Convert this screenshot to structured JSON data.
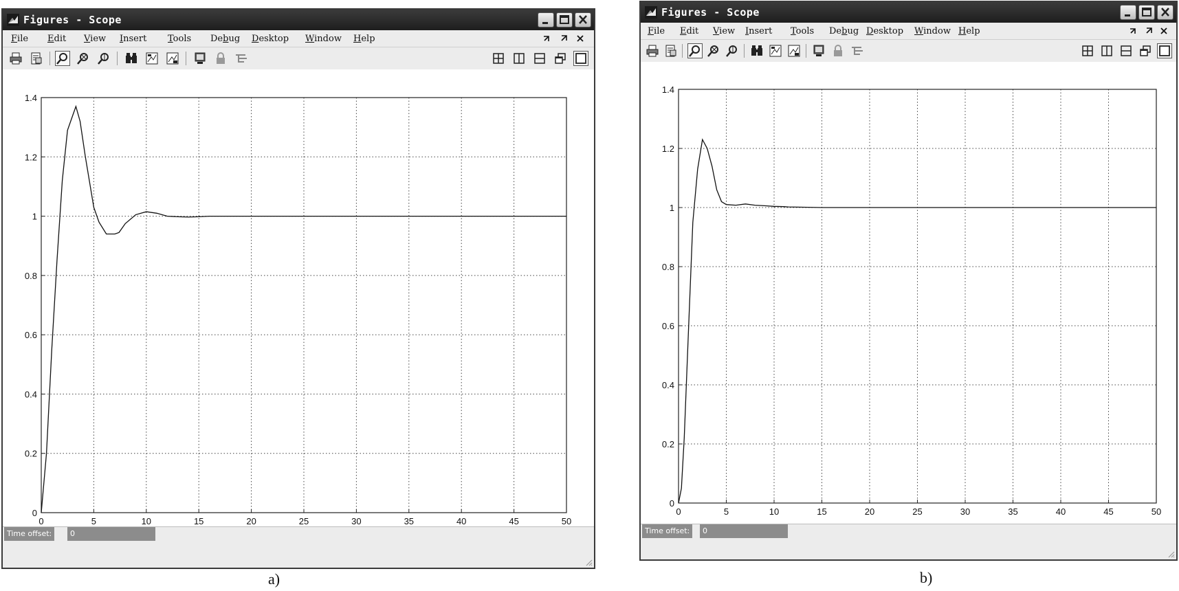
{
  "windows": [
    {
      "title": "Figures - Scope",
      "caption": "a)",
      "menu": [
        {
          "label": "File",
          "mnemonic": "F"
        },
        {
          "label": "Edit",
          "mnemonic": "E"
        },
        {
          "label": "View",
          "mnemonic": "V"
        },
        {
          "label": "Insert",
          "mnemonic": "I"
        },
        {
          "label": "Tools",
          "mnemonic": "T"
        },
        {
          "label": "Debug",
          "mnemonic": "b"
        },
        {
          "label": "Desktop",
          "mnemonic": "D"
        },
        {
          "label": "Window",
          "mnemonic": "W"
        },
        {
          "label": "Help",
          "mnemonic": "H"
        }
      ],
      "time_offset_label": "Time offset:",
      "time_offset_value": "0"
    },
    {
      "title": "Figures - Scope",
      "caption": "b)",
      "menu": [
        {
          "label": "File",
          "mnemonic": "F"
        },
        {
          "label": "Edit",
          "mnemonic": "E"
        },
        {
          "label": "View",
          "mnemonic": "V"
        },
        {
          "label": "Insert",
          "mnemonic": "I"
        },
        {
          "label": "Tools",
          "mnemonic": "T"
        },
        {
          "label": "Debug",
          "mnemonic": "b"
        },
        {
          "label": "Desktop",
          "mnemonic": "D"
        },
        {
          "label": "Window",
          "mnemonic": "W"
        },
        {
          "label": "Help",
          "mnemonic": "H"
        }
      ],
      "time_offset_label": "Time offset:",
      "time_offset_value": "0"
    }
  ],
  "icons": {
    "title": "matlab-icon",
    "title_buttons": [
      "minimize-icon",
      "maximize-icon",
      "close-icon"
    ],
    "menu_right": [
      "undock-arrow-icon",
      "dock-arrow-icon",
      "close-figure-icon"
    ],
    "toolbar_left": [
      "print-icon",
      "print-preview-icon",
      "zoom-icon",
      "zoom-x-icon",
      "zoom-y-icon",
      "find-icon",
      "save-axes-icon",
      "restore-axes-icon",
      "scope-params-icon",
      "float-lock-icon",
      "signal-select-icon"
    ],
    "toolbar_right": [
      "tile-2x2-icon",
      "tile-columns-icon",
      "tile-rows-icon",
      "float-icon",
      "dock-icon"
    ]
  },
  "chart_data": [
    {
      "type": "line",
      "title": "",
      "xlabel": "",
      "ylabel": "",
      "xlim": [
        0,
        50
      ],
      "ylim": [
        0,
        1.4
      ],
      "xticks": [
        0,
        5,
        10,
        15,
        20,
        25,
        30,
        35,
        40,
        45,
        50
      ],
      "yticks": [
        0,
        0.2,
        0.4,
        0.6,
        0.8,
        1,
        1.2,
        1.4
      ],
      "xtick_labels": [
        "0",
        "5",
        "10",
        "15",
        "20",
        "25",
        "30",
        "35",
        "40",
        "45",
        "50"
      ],
      "ytick_labels": [
        "0",
        "0.2",
        "0.4",
        "0.6",
        "0.8",
        "1",
        "1.2",
        "1.4"
      ],
      "grid": true,
      "x": [
        0,
        0.5,
        1,
        1.5,
        2,
        2.5,
        3,
        3.3,
        3.7,
        4.2,
        5,
        5.5,
        6.2,
        7,
        7.4,
        8,
        9,
        10,
        11,
        12,
        13,
        14,
        15,
        16,
        20,
        30,
        40,
        50
      ],
      "y": [
        0,
        0.2,
        0.55,
        0.85,
        1.12,
        1.29,
        1.34,
        1.37,
        1.32,
        1.2,
        1.03,
        0.98,
        0.94,
        0.94,
        0.945,
        0.975,
        1.005,
        1.015,
        1.01,
        1.0,
        0.998,
        0.997,
        0.998,
        1.0,
        1.0,
        1.0,
        1.0,
        1.0
      ]
    },
    {
      "type": "line",
      "title": "",
      "xlabel": "",
      "ylabel": "",
      "xlim": [
        0,
        50
      ],
      "ylim": [
        0,
        1.4
      ],
      "xticks": [
        0,
        5,
        10,
        15,
        20,
        25,
        30,
        35,
        40,
        45,
        50
      ],
      "yticks": [
        0,
        0.2,
        0.4,
        0.6,
        0.8,
        1,
        1.2,
        1.4
      ],
      "xtick_labels": [
        "0",
        "5",
        "10",
        "15",
        "20",
        "25",
        "30",
        "35",
        "40",
        "45",
        "50"
      ],
      "ytick_labels": [
        "0",
        "0.2",
        "0.4",
        "0.6",
        "0.8",
        "1",
        "1.2",
        "1.4"
      ],
      "grid": true,
      "x": [
        0,
        0.3,
        0.6,
        1,
        1.5,
        2,
        2.5,
        3,
        3.5,
        4,
        4.5,
        5,
        6,
        7,
        8,
        9,
        10,
        11,
        11.5,
        15,
        30,
        50
      ],
      "y": [
        0,
        0.05,
        0.22,
        0.55,
        0.95,
        1.13,
        1.23,
        1.2,
        1.14,
        1.06,
        1.02,
        1.01,
        1.008,
        1.012,
        1.008,
        1.006,
        1.004,
        1.003,
        1.002,
        1.0,
        1.0,
        1.0
      ]
    }
  ]
}
